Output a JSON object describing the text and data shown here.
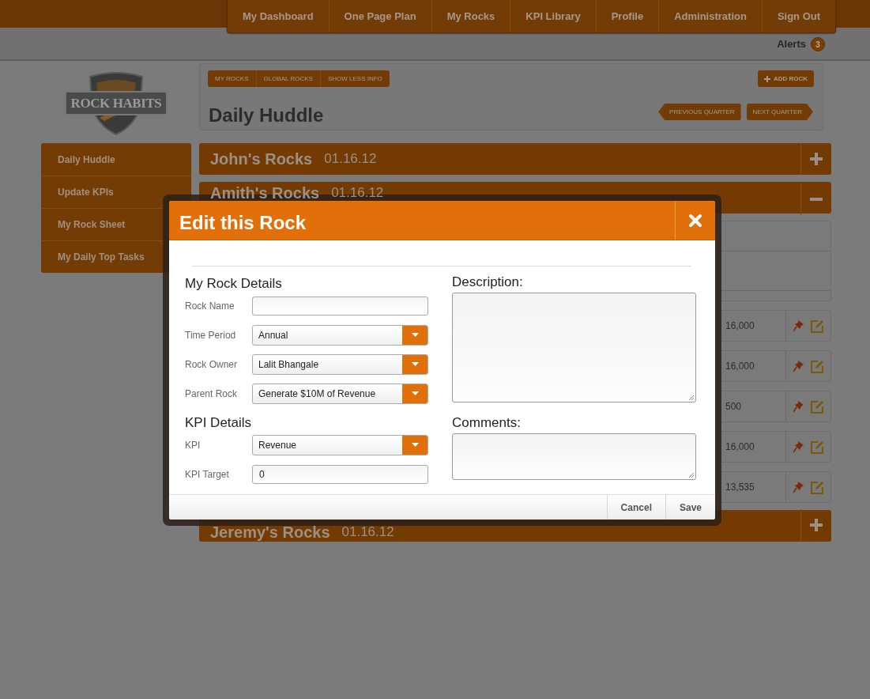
{
  "nav": [
    "My Dashboard",
    "One Page Plan",
    "My Rocks",
    "KPI Library",
    "Profile",
    "Administration",
    "Sign Out"
  ],
  "alerts": {
    "label": "Alerts",
    "count": "3"
  },
  "logo": {
    "text": "ROCK HABITS"
  },
  "view_tabs": [
    "MY ROCKS",
    "GLOBAL ROCKS",
    "SHOW LESS INFO"
  ],
  "add_button": "ADD ROCK",
  "page_title": "Daily Huddle",
  "quarter_buttons": {
    "previous": "PREVIOUS QUARTER",
    "next": "NEXT QUARTER"
  },
  "sidebar": {
    "items": [
      "Daily Huddle",
      "Update KPIs",
      "My Rock Sheet",
      "My Daily Top Tasks"
    ]
  },
  "rock_groups": [
    {
      "name": "John's Rocks",
      "date": "01.16.12",
      "expanded": false
    },
    {
      "name": "Amith's Rocks",
      "date": "01.16.12",
      "expanded": true,
      "rows": [
        {
          "value": "16,000"
        },
        {
          "value": "16,000"
        },
        {
          "value": "500"
        },
        {
          "value": "16,000"
        },
        {
          "value": "13,535"
        }
      ]
    },
    {
      "name": "Jeremy's Rocks",
      "date": "01.16.12",
      "expanded": false
    }
  ],
  "modal": {
    "title": "Edit this Rock",
    "sections": [
      {
        "heading": "My Rock Details",
        "fields": [
          {
            "label": "Rock Name",
            "kind": "text"
          },
          {
            "label": "Time Period",
            "kind": "select",
            "value": "Annual"
          },
          {
            "label": "Rock Owner",
            "kind": "select",
            "value": "Lalit Bhangale"
          },
          {
            "label": "Parent Rock",
            "kind": "select",
            "value": "Generate $10M of Revenue"
          }
        ]
      },
      {
        "heading": "KPI Details",
        "fields": [
          {
            "label": "KPI",
            "kind": "select",
            "value": "Revenue"
          },
          {
            "label": "KPI Target",
            "kind": "text",
            "value": "0"
          }
        ]
      }
    ],
    "description_label": "Description:",
    "comments_label": "Comments:",
    "buttons": [
      "Cancel",
      "Save"
    ]
  }
}
